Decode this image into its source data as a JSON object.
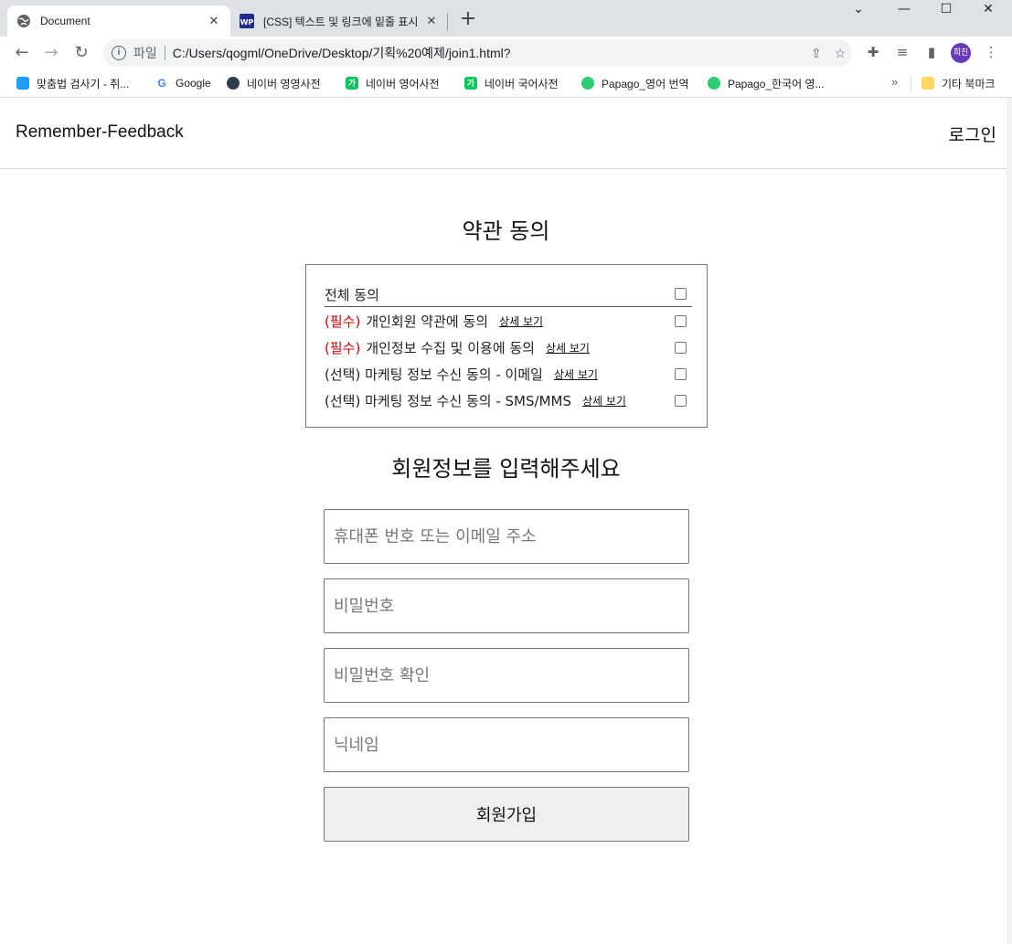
{
  "browser": {
    "tabs": [
      {
        "title": "Document",
        "close": "✕"
      },
      {
        "title": "[CSS] 텍스트 및 링크에 밑줄 표시",
        "close": "✕"
      }
    ],
    "new_tab": "+",
    "window_controls": {
      "minimize": "—",
      "maximize": "☐",
      "close": "✕"
    },
    "address": {
      "scheme": "파일",
      "url": "C:/Users/qogml/OneDrive/Desktop/기획%20예제/join1.html?"
    },
    "profile_initials": "희진",
    "bookmarks": [
      {
        "label": "맞춤법 검사기 - 취...",
        "color": "#1a73e8"
      },
      {
        "label": "Google",
        "color": "#4285f4"
      },
      {
        "label": "네이버 영영사전",
        "color": "#2d3e50"
      },
      {
        "label": "네이버 영어사전",
        "color": "#03c75a"
      },
      {
        "label": "네이버 국어사전",
        "color": "#03c75a"
      },
      {
        "label": "Papago_영어 번역",
        "color": "#2ecc71"
      },
      {
        "label": "Papago_한국어 영...",
        "color": "#2ecc71"
      }
    ],
    "bookmarks_more": "»",
    "other_bookmarks": "기타 북마크"
  },
  "header": {
    "brand": "Remember-Feedback",
    "login": "로그인"
  },
  "terms": {
    "title": "약관 동의",
    "all_label": "전체 동의",
    "items": [
      {
        "tag": "(필수)",
        "text": "개인회원 약관에 동의",
        "detail": "상세 보기"
      },
      {
        "tag": "(필수)",
        "text": "개인정보 수집 및 이용에 동의",
        "detail": "상세 보기"
      },
      {
        "tag": "",
        "text": "(선택) 마케팅 정보 수신 동의 - 이메일",
        "detail": "상세 보기"
      },
      {
        "tag": "",
        "text": "(선택) 마케팅 정보 수신 동의 - SMS/MMS",
        "detail": "상세 보기"
      }
    ]
  },
  "form": {
    "title": "회원정보를 입력해주세요",
    "phone_email_placeholder": "휴대폰 번호 또는 이메일 주소",
    "password_placeholder": "비밀번호",
    "password_confirm_placeholder": "비밀번호 확인",
    "nickname_placeholder": "닉네임",
    "submit_label": "회원가입"
  },
  "colors": {
    "required": "#d90000",
    "chrome_bg": "#dee1e6",
    "profile": "#673ab7"
  }
}
